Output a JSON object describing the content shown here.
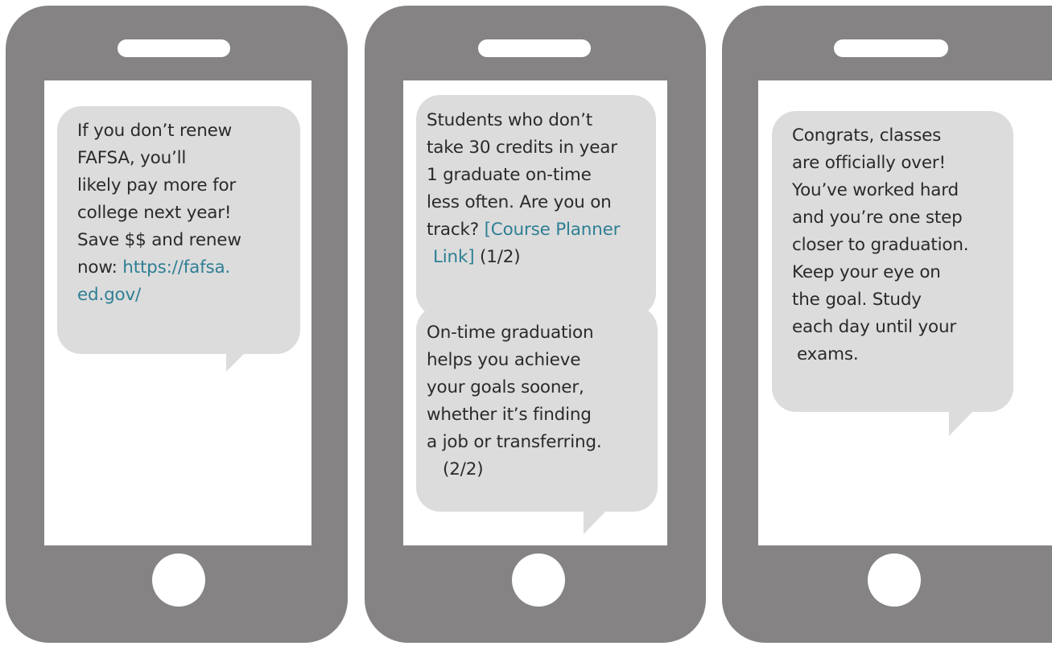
{
  "colors": {
    "phone_body": "#858384",
    "bubble": "#dcdcdd",
    "text": "#2a2a2a",
    "link": "#2f7f93"
  },
  "phones": [
    {
      "messages": [
        {
          "lines": [
            "If you don’t renew",
            "FAFSA, you’ll",
            "likely pay more for",
            "college next year!",
            "Save $$ and renew"
          ],
          "link_prefix": "now: ",
          "link_line1": "https://fafsa.",
          "link_line2": "ed.gov/"
        }
      ]
    },
    {
      "messages": [
        {
          "lines": [
            "Students who don’t",
            "take 30 credits in year",
            "1 graduate on-time",
            "less often. Are you on"
          ],
          "link_prefix": "track? ",
          "link_line1": "[Course Planner",
          "link_line2": "Link]",
          "link_suffix": " (1/2)"
        },
        {
          "lines": [
            "On-time graduation",
            "helps you achieve",
            "your goals sooner,",
            "whether it’s finding",
            "a job or transferring.",
            "(2/2)"
          ]
        }
      ]
    },
    {
      "messages": [
        {
          "lines": [
            "Congrats, classes",
            "are officially over!",
            "You’ve worked hard",
            "and you’re one step",
            "closer to graduation.",
            "Keep your eye on",
            "the goal. Study",
            "each day until your",
            "exams."
          ]
        }
      ]
    }
  ]
}
